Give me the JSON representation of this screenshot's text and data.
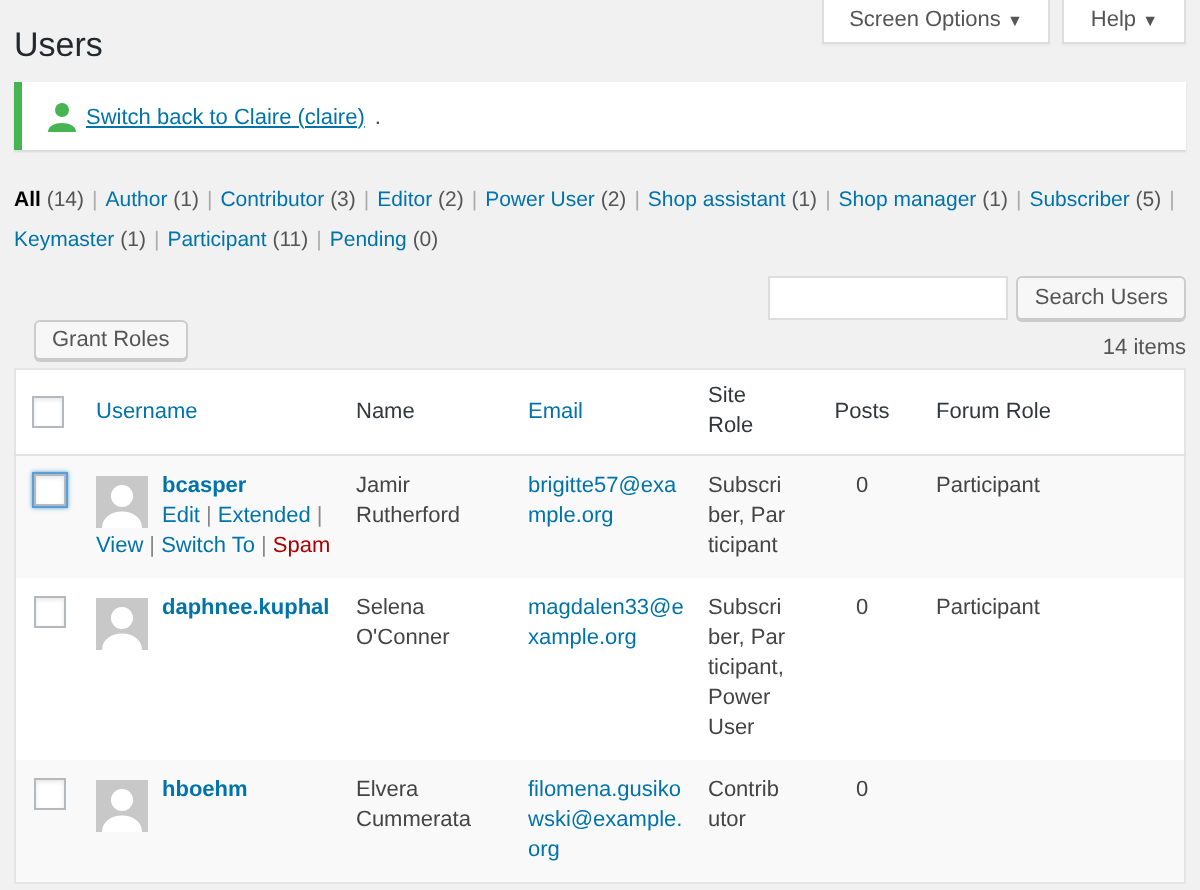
{
  "header": {
    "title": "Users",
    "buttons": [
      {
        "label": "Screen Options",
        "caret": "▼"
      },
      {
        "label": "Help",
        "caret": "▼"
      }
    ]
  },
  "notice": {
    "link": "Switch back to Claire (claire)",
    "trail": "."
  },
  "filters": [
    {
      "label": "All",
      "count": "(14)",
      "selected": true,
      "separator": "|"
    },
    {
      "label": "Author",
      "count": "(1)",
      "selected": false,
      "separator": "|"
    },
    {
      "label": "Contributor",
      "count": "(3)",
      "selected": false,
      "separator": "|"
    },
    {
      "label": "Editor",
      "count": "(2)",
      "selected": false,
      "separator": "|"
    },
    {
      "label": "Power User",
      "count": "(2)",
      "selected": false,
      "separator": "|"
    },
    {
      "label": "Shop assistant",
      "count": "(1)",
      "selected": false,
      "separator": "|"
    },
    {
      "label": "Shop manager",
      "count": "(1)",
      "selected": false,
      "separator": "|"
    },
    {
      "label": "Subscriber",
      "count": "(5)",
      "selected": false,
      "separator": "|"
    },
    {
      "label": "Keymaster",
      "count": "(1)",
      "selected": false,
      "separator": "|"
    },
    {
      "label": "Participant",
      "count": "(11)",
      "selected": false,
      "separator": "|"
    },
    {
      "label": "Pending",
      "count": "(0)",
      "selected": false
    }
  ],
  "search": {
    "button": "Search Users"
  },
  "bulk": {
    "button": "Grant Roles",
    "count": "14 items"
  },
  "table": {
    "columns": [
      {
        "label": "Username",
        "sortable": true
      },
      {
        "label": "Name",
        "sortable": false
      },
      {
        "label": "Email",
        "sortable": true
      },
      {
        "label": "Site Role",
        "sortable": false
      },
      {
        "label": "Posts",
        "sortable": false
      },
      {
        "label": "Forum Role",
        "sortable": false
      }
    ],
    "header_checked": false,
    "rows": [
      {
        "username": "bcasper",
        "name": "Jamir Rutherford",
        "email": "brigitte57@example.org",
        "site_role": "Subscriber, Participant",
        "posts": "0",
        "forum_role": "Participant",
        "checked": false,
        "focused": true,
        "actions": [
          {
            "label": "Edit",
            "kind": "link",
            "separator": "|"
          },
          {
            "label": "Extended",
            "kind": "link",
            "separator": "|"
          },
          {
            "label": "View",
            "kind": "link",
            "separator": "|"
          },
          {
            "label": "Switch To",
            "kind": "link",
            "separator": "|"
          },
          {
            "label": "Spam",
            "kind": "danger"
          }
        ]
      },
      {
        "username": "daphnee.kuphal",
        "name": "Selena O'Conner",
        "email": "magdalen33@example.org",
        "site_role": "Subscriber, Participant, Power User",
        "posts": "0",
        "forum_role": "Participant",
        "checked": false,
        "focused": false,
        "actions": []
      },
      {
        "username": "hboehm",
        "name": "Elvera Cummerata",
        "email": "filomena.gusikowski@example.org",
        "site_role": "Contributor",
        "posts": "0",
        "checked": false,
        "focused": false,
        "actions": []
      }
    ]
  }
}
